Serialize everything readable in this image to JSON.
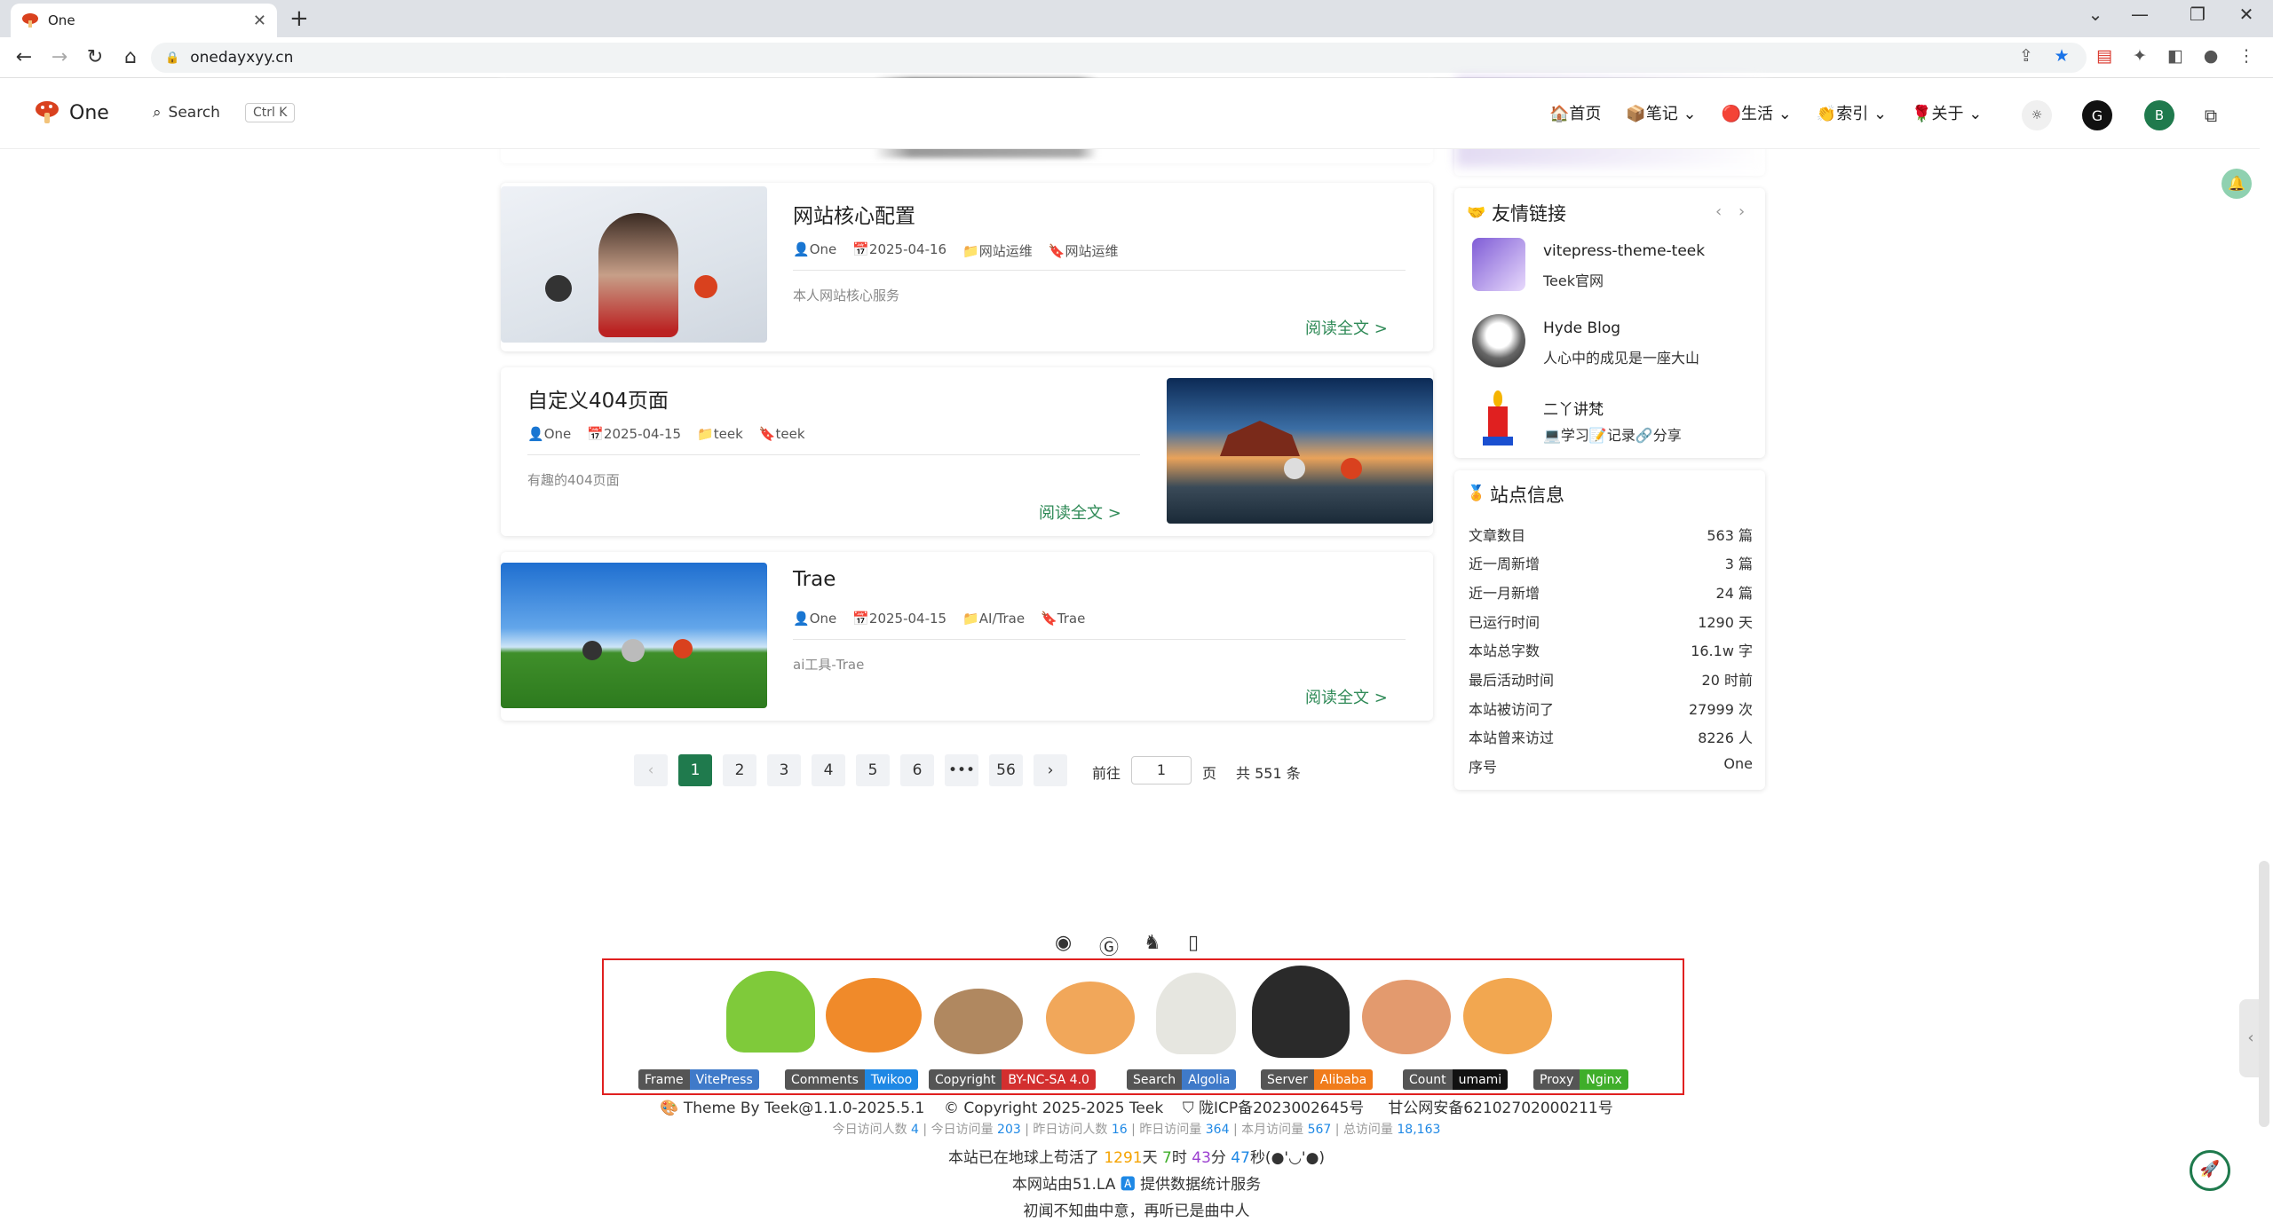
{
  "browser": {
    "tab_title": "One",
    "url": "onedayxyy.cn"
  },
  "site": {
    "logo_text": "One",
    "search_label": "Search",
    "search_kbd": "Ctrl K",
    "menu": [
      "🏠首页",
      "📦笔记 ⌄",
      "🔴生活 ⌄",
      "👏索引 ⌄",
      "🌹关于 ⌄"
    ],
    "avatar_letter": "B"
  },
  "posts": [
    {
      "title": "网站核心配置",
      "author": "One",
      "date": "2025-04-16",
      "category": "网站运维",
      "tag": "网站运维",
      "desc": "本人网站核心服务",
      "more": "阅读全文 >"
    },
    {
      "title": "自定义404页面",
      "author": "One",
      "date": "2025-04-15",
      "category": "teek",
      "tag": "teek",
      "desc": "有趣的404页面",
      "more": "阅读全文 >"
    },
    {
      "title": "Trae",
      "author": "One",
      "date": "2025-04-15",
      "category": "AI/Trae",
      "tag": "Trae",
      "desc": "ai工具-Trae",
      "more": "阅读全文 >"
    }
  ],
  "pagination": {
    "pages": [
      "1",
      "2",
      "3",
      "4",
      "5",
      "6",
      "•••",
      "56"
    ],
    "prev": "‹",
    "next": "›",
    "goto_label": "前往",
    "goto_value": "1",
    "page_unit": "页",
    "total": "共 551 条"
  },
  "friends": {
    "title": "友情链接",
    "items": [
      {
        "name": "vitepress-theme-teek",
        "desc": "Teek官网"
      },
      {
        "name": "Hyde Blog",
        "desc": "人心中的成见是一座大山"
      },
      {
        "name": "二丫讲梵",
        "desc": "💻学习📝记录🔗分享"
      }
    ]
  },
  "site_info": {
    "title": "站点信息",
    "rows": [
      {
        "label": "文章数目",
        "value": "563 篇"
      },
      {
        "label": "近一周新增",
        "value": "3 篇"
      },
      {
        "label": "近一月新增",
        "value": "24 篇"
      },
      {
        "label": "已运行时间",
        "value": "1290 天"
      },
      {
        "label": "本站总字数",
        "value": "16.1w 字"
      },
      {
        "label": "最后活动时间",
        "value": "20 时前"
      },
      {
        "label": "本站被访问了",
        "value": "27999 次"
      },
      {
        "label": "本站曾来访过",
        "value": "8226 人"
      },
      {
        "label": "序号",
        "value": "One"
      }
    ]
  },
  "footer": {
    "badges": [
      {
        "k": "Frame",
        "v": "VitePress",
        "c": "#3f7ac9"
      },
      {
        "k": "Comments",
        "v": "Twikoo",
        "c": "#1e88e5"
      },
      {
        "k": "Copyright",
        "v": "BY-NC-SA 4.0",
        "c": "#d32f2f"
      },
      {
        "k": "Search",
        "v": "Algolia",
        "c": "#3f7ac9"
      },
      {
        "k": "Server",
        "v": "Alibaba",
        "c": "#f07c1b"
      },
      {
        "k": "Count",
        "v": "umami",
        "c": "#111111"
      },
      {
        "k": "Proxy",
        "v": "Nginx",
        "c": "#3fae2a"
      }
    ],
    "theme_by": "Theme By Teek@1.1.0-2025.5.1",
    "copyright": "Copyright 2025-2025 Teek",
    "icp": "陇ICP备2023002645号",
    "police": "甘公网安备62102702000211号",
    "stats": [
      {
        "label": "今日访问人数",
        "value": "4"
      },
      {
        "label": "今日访问量",
        "value": "203"
      },
      {
        "label": "昨日访问人数",
        "value": "16"
      },
      {
        "label": "昨日访问量",
        "value": "364"
      },
      {
        "label": "本月访问量",
        "value": "567"
      },
      {
        "label": "总访问量",
        "value": "18,163"
      }
    ],
    "alive_prefix": "本站已在地球上苟活了",
    "alive_days": "1291",
    "alive_d": "天",
    "alive_hours": "7",
    "alive_h": "时",
    "alive_min": "43",
    "alive_m": "分",
    "alive_sec": "47",
    "alive_suffix": "秒(●'◡'●)",
    "la_prefix": "本网站由51.LA",
    "la_suffix": "提供数据统计服务",
    "motto": "初闻不知曲中意，再听已是曲中人"
  }
}
